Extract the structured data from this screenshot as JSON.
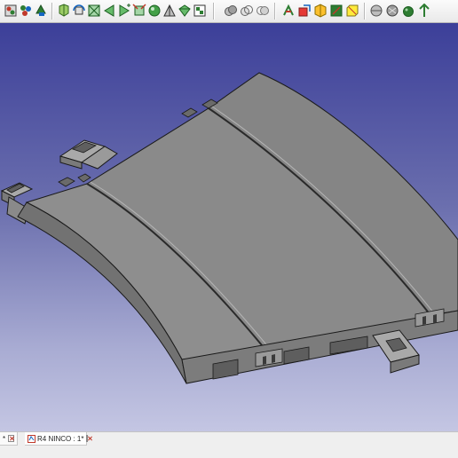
{
  "toolbar": {
    "groups": [
      {
        "name": "view-tools",
        "icons": [
          "fit-all-icon",
          "fit-selection-icon",
          "draw-style-icon",
          "sync-view-icon",
          "std-views-icon",
          "view-front-icon",
          "view-top-icon",
          "view-right-icon",
          "view-rear-icon",
          "view-bottom-icon",
          "view-left-icon",
          "measure-icon"
        ]
      },
      {
        "name": "part-boolean-tools",
        "icons": [
          "cut-icon",
          "fuse-icon",
          "common-icon"
        ]
      },
      {
        "name": "part-design-tools",
        "icons": [
          "extrude-icon",
          "revolve-icon",
          "mirror-icon",
          "fillet-icon",
          "chamfer-icon",
          "section-icon",
          "cross-sections-icon"
        ]
      }
    ]
  },
  "tabs": [
    {
      "label": "*",
      "active": false
    },
    {
      "label": "R4 NINCO : 1*",
      "active": true
    }
  ],
  "colors": {
    "viewport_top": "#3c3f99",
    "viewport_bottom": "#c4c6e3",
    "model_face": "#8c8c8c",
    "model_side": "#6e6e6e",
    "model_edge": "#1a1a1a"
  }
}
